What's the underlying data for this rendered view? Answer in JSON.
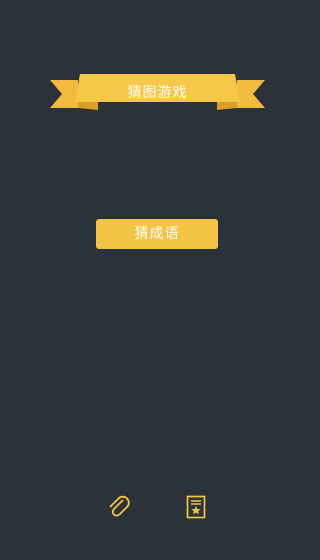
{
  "app": {
    "title": "猜图游戏"
  },
  "main": {
    "start_label": "猜成语"
  },
  "footer": {
    "icons": [
      "paperclip-icon",
      "bookmark-star-icon"
    ]
  },
  "colors": {
    "background": "#2c3239",
    "accent": "#f4c444",
    "accent_dark": "#e0a92e",
    "text": "#ffffff"
  }
}
